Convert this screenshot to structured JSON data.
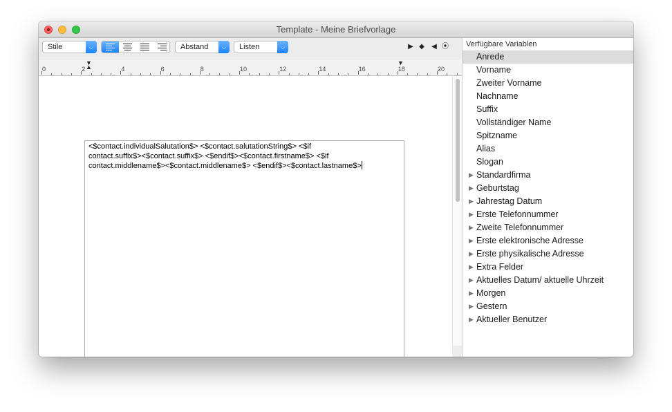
{
  "window": {
    "title": "Template - Meine Briefvorlage"
  },
  "toolbar": {
    "styles_popup": "Stile",
    "spacing_popup": "Abstand",
    "lists_popup": "Listen"
  },
  "ruler": {
    "labels": [
      "0",
      "2",
      "4",
      "6",
      "8",
      "10",
      "12",
      "14",
      "16",
      "18",
      "20"
    ]
  },
  "document": {
    "lines": [
      "<$contact.individualSalutation$> <$contact.salutationString$> <$if",
      "contact.suffix$><$contact.suffix$> <$endif$><$contact.firstname$> <$if",
      "contact.middlename$><$contact.middlename$> <$endif$><$contact.lastname$>"
    ]
  },
  "sidebar": {
    "header": "Verfügbare Variablen",
    "selected_index": 0,
    "items": [
      {
        "label": "Anrede",
        "expandable": false
      },
      {
        "label": "Vorname",
        "expandable": false
      },
      {
        "label": "Zweiter Vorname",
        "expandable": false
      },
      {
        "label": "Nachname",
        "expandable": false
      },
      {
        "label": "Suffix",
        "expandable": false
      },
      {
        "label": "Vollständiger Name",
        "expandable": false
      },
      {
        "label": "Spitzname",
        "expandable": false
      },
      {
        "label": "Alias",
        "expandable": false
      },
      {
        "label": "Slogan",
        "expandable": false
      },
      {
        "label": "Standardfirma",
        "expandable": true
      },
      {
        "label": "Geburtstag",
        "expandable": true
      },
      {
        "label": "Jahrestag Datum",
        "expandable": true
      },
      {
        "label": "Erste Telefonnummer",
        "expandable": true
      },
      {
        "label": "Zweite Telefonnummer",
        "expandable": true
      },
      {
        "label": "Erste elektronische Adresse",
        "expandable": true
      },
      {
        "label": "Erste physikalische Adresse",
        "expandable": true
      },
      {
        "label": "Extra Felder",
        "expandable": true
      },
      {
        "label": "Aktuelles Datum/ aktuelle Uhrzeit",
        "expandable": true
      },
      {
        "label": "Morgen",
        "expandable": true
      },
      {
        "label": "Gestern",
        "expandable": true
      },
      {
        "label": "Aktueller Benutzer",
        "expandable": true
      }
    ]
  }
}
